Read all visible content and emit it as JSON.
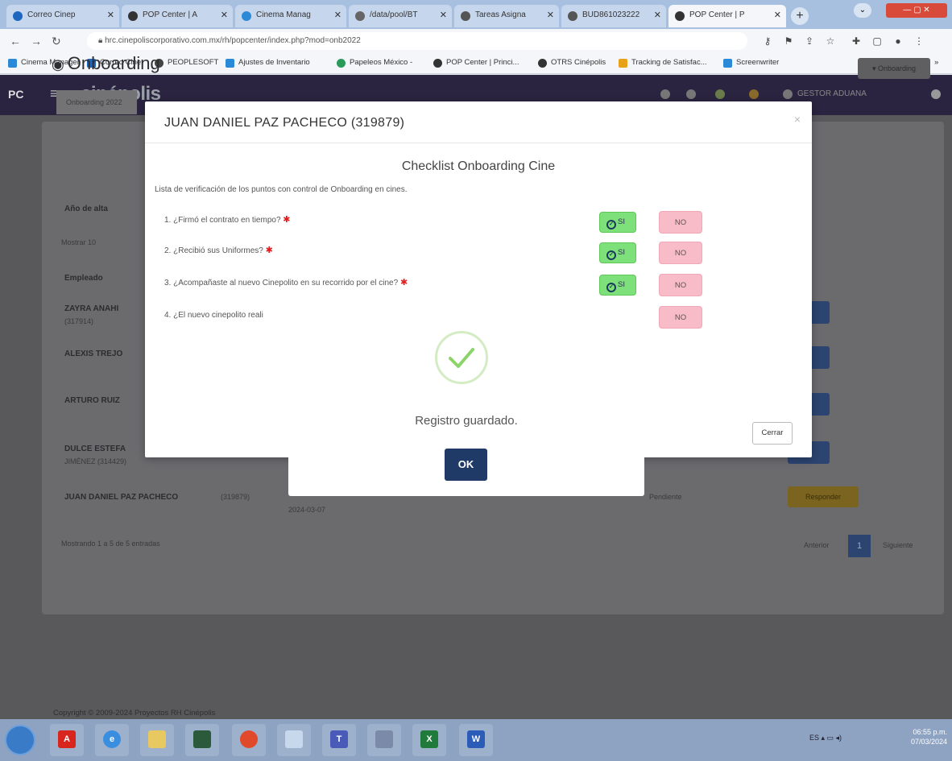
{
  "browser": {
    "tabs": [
      {
        "label": "Correo Cinep",
        "color": "#1f66c1"
      },
      {
        "label": "POP Center | A",
        "color": "#333"
      },
      {
        "label": "Cinema Manag",
        "color": "#2a8ad8"
      },
      {
        "label": "/data/pool/BT",
        "color": "#666"
      },
      {
        "label": "Tareas Asigna",
        "color": "#555"
      },
      {
        "label": "BUD861023222",
        "color": "#555"
      },
      {
        "label": "POP Center | P",
        "color": "#333"
      }
    ],
    "url": "hrc.cinepoliscorporativo.com.mx/rh/popcenter/index.php?mod=onb2022",
    "bookmarks": [
      {
        "label": "Cinema Manager",
        "color": "#2a8ad8"
      },
      {
        "label": "Correo Cine",
        "color": "#1f66c1"
      },
      {
        "label": "PEOPLESOFT",
        "color": "#444"
      },
      {
        "label": "Ajustes de Inventario",
        "color": "#2a8ad8"
      },
      {
        "label": "Papeleos México -",
        "color": "#2a9a5a"
      },
      {
        "label": "POP Center | Princi...",
        "color": "#333"
      },
      {
        "label": "OTRS Cinépolis",
        "color": "#333"
      },
      {
        "label": "Tracking de Satisfac...",
        "color": "#e8a21a"
      },
      {
        "label": "Screenwriter",
        "color": "#2a8ad8"
      }
    ]
  },
  "app": {
    "brand": "cinépolis",
    "pc_label": "PC",
    "user": "GESTOR ADUANA",
    "page_title": "Onboarding",
    "dropdown_label": "▾ Onboarding",
    "tab_label": "Onboarding 2022",
    "year_label": "Año de alta",
    "show_label": "Mostrar 10",
    "col_employee": "Empleado",
    "employees": [
      {
        "name": "ZAYRA ANAHI",
        "sub": "(317914)"
      },
      {
        "name": "ALEXIS TREJO",
        "sub": ""
      },
      {
        "name": "ARTURO RUIZ",
        "sub": ""
      },
      {
        "name": "DULCE ESTEFA",
        "sub": "JIMÉNEZ (314429)"
      },
      {
        "name": "JUAN DANIEL PAZ PACHECO",
        "sub": "(319879)"
      }
    ],
    "last_row_date": "2024-03-07",
    "last_row_status": "Pendiente",
    "badge": "Responder",
    "pagination_info": "Mostrando 1 a 5 de 5 entradas",
    "prev": "Anterior",
    "page_num": "1",
    "next": "Siguiente",
    "footer": "Copyright © 2009-2024 Proyectos RH Cinépolis"
  },
  "modal": {
    "title": "JUAN DANIEL PAZ PACHECO (319879)",
    "checklist_title": "Checklist Onboarding Cine",
    "checklist_desc": "Lista de verificación de los puntos con control de Onboarding en cines.",
    "questions": [
      {
        "text": "1. ¿Firmó el contrato en tiempo?",
        "required": "✱",
        "yes": "SI",
        "no": "NO"
      },
      {
        "text": "2. ¿Recibió sus Uniformes?",
        "required": "✱",
        "yes": "SI",
        "no": "NO"
      },
      {
        "text": "3. ¿Acompañaste al nuevo Cinepolito en su recorrido por el cine?",
        "required": "✱",
        "yes": "SI",
        "no": "NO"
      },
      {
        "text": "4. ¿El nuevo cinepolito reali",
        "required": "",
        "yes": "",
        "no": "NO"
      }
    ],
    "close_label": "Cerrar"
  },
  "alert": {
    "message": "Registro guardado.",
    "ok_label": "OK"
  },
  "taskbar": {
    "clock_time": "06:55 p.m.",
    "clock_date": "07/03/2024",
    "tray": "ES"
  }
}
